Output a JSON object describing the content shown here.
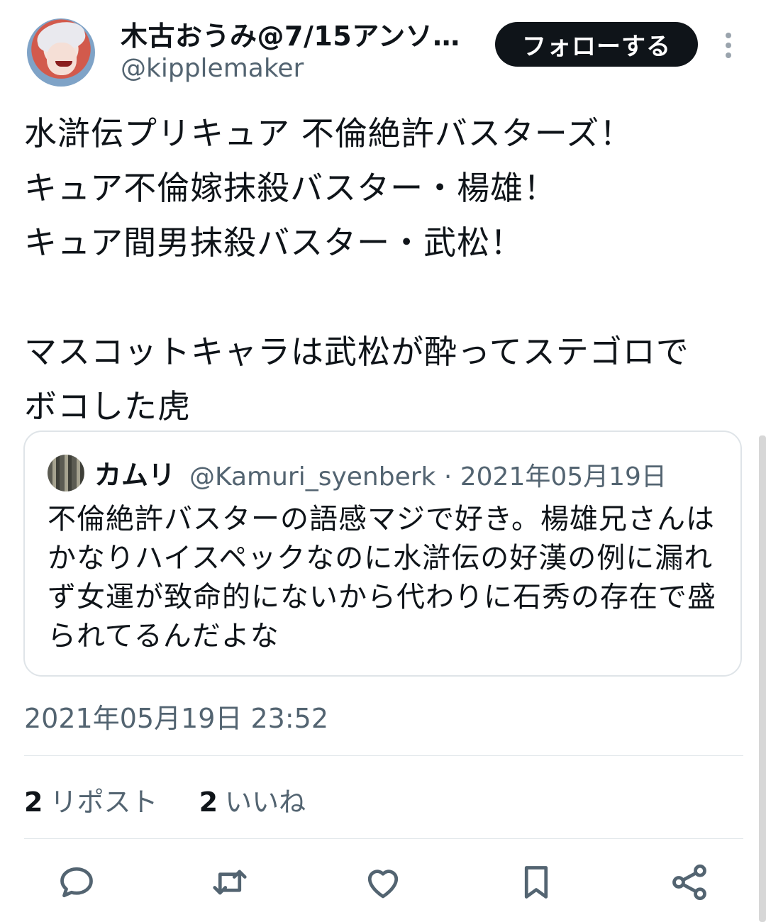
{
  "header": {
    "display_name": "木古おうみ@7/15アンソ…",
    "handle": "@kipplemaker",
    "follow_label": "フォローする"
  },
  "tweet": {
    "text": "水滸伝プリキュア 不倫絶許バスターズ！\nキュア不倫嫁抹殺バスター・楊雄！\nキュア間男抹殺バスター・武松！\n\nマスコットキャラは武松が酔ってステゴロで\nボコした虎",
    "timestamp": "2021年05月19日 23:52"
  },
  "quote": {
    "name": "カムリ",
    "handle_date": "@Kamuri_syenberk · 2021年05月19日",
    "text": "不倫絶許バスターの語感マジで好き。楊雄兄さんはかなりハイスペックなのに水滸伝の好漢の例に漏れず女運が致命的にないから代わりに石秀の存在で盛られてるんだよな"
  },
  "stats": {
    "reposts_count": "2",
    "reposts_label": "リポスト",
    "likes_count": "2",
    "likes_label": "いいね"
  },
  "actions": {
    "icons": [
      "reply-icon",
      "repost-icon",
      "like-icon",
      "bookmark-icon",
      "share-icon"
    ]
  },
  "colors": {
    "text": "#0f1419",
    "secondary": "#536471",
    "button_bg": "#0f1419",
    "border": "#dfe4e8"
  }
}
